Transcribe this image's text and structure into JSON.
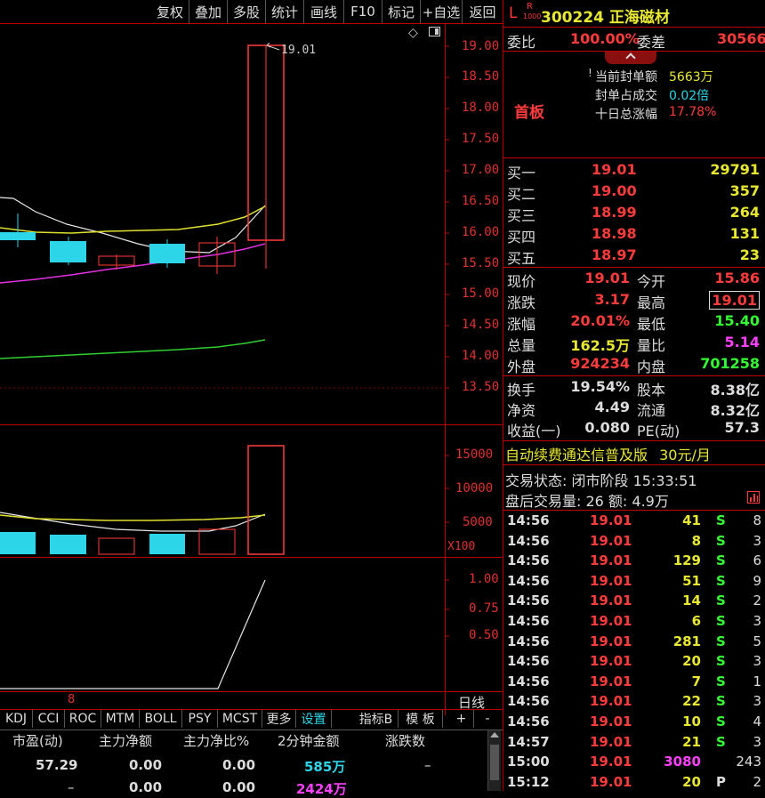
{
  "toolbar": {
    "items": [
      "复权",
      "叠加",
      "多股",
      "统计",
      "画线",
      "F10",
      "标记",
      "+自选",
      "返回"
    ]
  },
  "stock": {
    "badge_l": "L",
    "badge_r": "R",
    "badge_sub": "1000",
    "code_name": "300224 正海磁材"
  },
  "weibi": {
    "label": "委比",
    "value": "100.00%",
    "label2": "委差",
    "value2": "30566"
  },
  "seal": {
    "tag": "首板",
    "rows": [
      {
        "label": "当前封单额",
        "value": "5663万"
      },
      {
        "label": "封单占成交",
        "value": "0.02倍"
      },
      {
        "label": "十日总涨幅",
        "value": "17.78%"
      }
    ]
  },
  "bids": [
    {
      "label": "买一",
      "price": "19.01",
      "vol": "29791"
    },
    {
      "label": "买二",
      "price": "19.00",
      "vol": "357"
    },
    {
      "label": "买三",
      "price": "18.99",
      "vol": "264"
    },
    {
      "label": "买四",
      "price": "18.98",
      "vol": "131"
    },
    {
      "label": "买五",
      "price": "18.97",
      "vol": "23"
    }
  ],
  "quote": [
    {
      "l1": "现价",
      "v1": "19.01",
      "l2": "今开",
      "v2": "15.86"
    },
    {
      "l1": "涨跌",
      "v1": "3.17",
      "l2": "最高",
      "v2": "19.01"
    },
    {
      "l1": "涨幅",
      "v1": "20.01%",
      "l2": "最低",
      "v2": "15.40"
    },
    {
      "l1": "总量",
      "v1": "162.5万",
      "l2": "量比",
      "v2": "5.14"
    },
    {
      "l1": "外盘",
      "v1": "924234",
      "l2": "内盘",
      "v2": "701258"
    }
  ],
  "fund": [
    {
      "l1": "换手",
      "v1": "19.54%",
      "l2": "股本",
      "v2": "8.38亿"
    },
    {
      "l1": "净资",
      "v1": "4.49",
      "l2": "流通",
      "v2": "8.32亿"
    },
    {
      "l1": "收益(一)",
      "v1": "0.080",
      "l2": "PE(动)",
      "v2": "57.3"
    }
  ],
  "promo": {
    "text": "自动续费通达信普及版",
    "price": "30元/月"
  },
  "trade_status": {
    "line1": "交易状态: 闭市阶段 15:33:51",
    "line2": "盘后交易量: 26  额: 4.9万"
  },
  "ticks": [
    {
      "time": "14:56",
      "price": "19.01",
      "vol": "41",
      "dir": "S",
      "n": "8"
    },
    {
      "time": "14:56",
      "price": "19.01",
      "vol": "8",
      "dir": "S",
      "n": "3"
    },
    {
      "time": "14:56",
      "price": "19.01",
      "vol": "129",
      "dir": "S",
      "n": "6"
    },
    {
      "time": "14:56",
      "price": "19.01",
      "vol": "51",
      "dir": "S",
      "n": "9"
    },
    {
      "time": "14:56",
      "price": "19.01",
      "vol": "14",
      "dir": "S",
      "n": "2"
    },
    {
      "time": "14:56",
      "price": "19.01",
      "vol": "6",
      "dir": "S",
      "n": "3"
    },
    {
      "time": "14:56",
      "price": "19.01",
      "vol": "281",
      "dir": "S",
      "n": "5"
    },
    {
      "time": "14:56",
      "price": "19.01",
      "vol": "20",
      "dir": "S",
      "n": "3"
    },
    {
      "time": "14:56",
      "price": "19.01",
      "vol": "7",
      "dir": "S",
      "n": "1"
    },
    {
      "time": "14:56",
      "price": "19.01",
      "vol": "22",
      "dir": "S",
      "n": "3"
    },
    {
      "time": "14:56",
      "price": "19.01",
      "vol": "10",
      "dir": "S",
      "n": "4"
    },
    {
      "time": "14:57",
      "price": "19.01",
      "vol": "21",
      "dir": "S",
      "n": "3"
    },
    {
      "time": "15:00",
      "price": "19.01",
      "vol": "3080",
      "dir": "",
      "n": "243"
    },
    {
      "time": "15:12",
      "price": "19.01",
      "vol": "20",
      "dir": "P",
      "n": "2"
    }
  ],
  "chart": {
    "price_ticks": [
      "19.00",
      "18.50",
      "18.00",
      "17.50",
      "17.00",
      "16.50",
      "16.00",
      "15.50",
      "15.00",
      "14.50",
      "14.00",
      "13.50"
    ],
    "high_label": "19.01",
    "vol_ticks": [
      "15000",
      "10000",
      "5000"
    ],
    "vol_unit": "X100",
    "ind_ticks": [
      "1.00",
      "0.75",
      "0.50"
    ],
    "x_marker": "8",
    "period": "日线"
  },
  "indicator_tabs": [
    "KDJ",
    "CCI",
    "ROC",
    "MTM",
    "BOLL",
    "PSY",
    "MCST",
    "更多",
    "设置",
    "指标B",
    "模 板",
    "+",
    "-"
  ],
  "bottom_table": {
    "headers": [
      "市盈(动)",
      "主力净额",
      "主力净比%",
      "2分钟金额",
      "涨跌数"
    ],
    "rows": [
      [
        "57.29",
        "0.00",
        "0.00",
        "585万",
        "–"
      ],
      [
        "–",
        "0.00",
        "0.00",
        "2424万",
        ""
      ]
    ]
  },
  "colors": {
    "up": "#ff3b3b",
    "down": "#2cd5e8",
    "bg": "#000000",
    "grid": "#b00000"
  }
}
